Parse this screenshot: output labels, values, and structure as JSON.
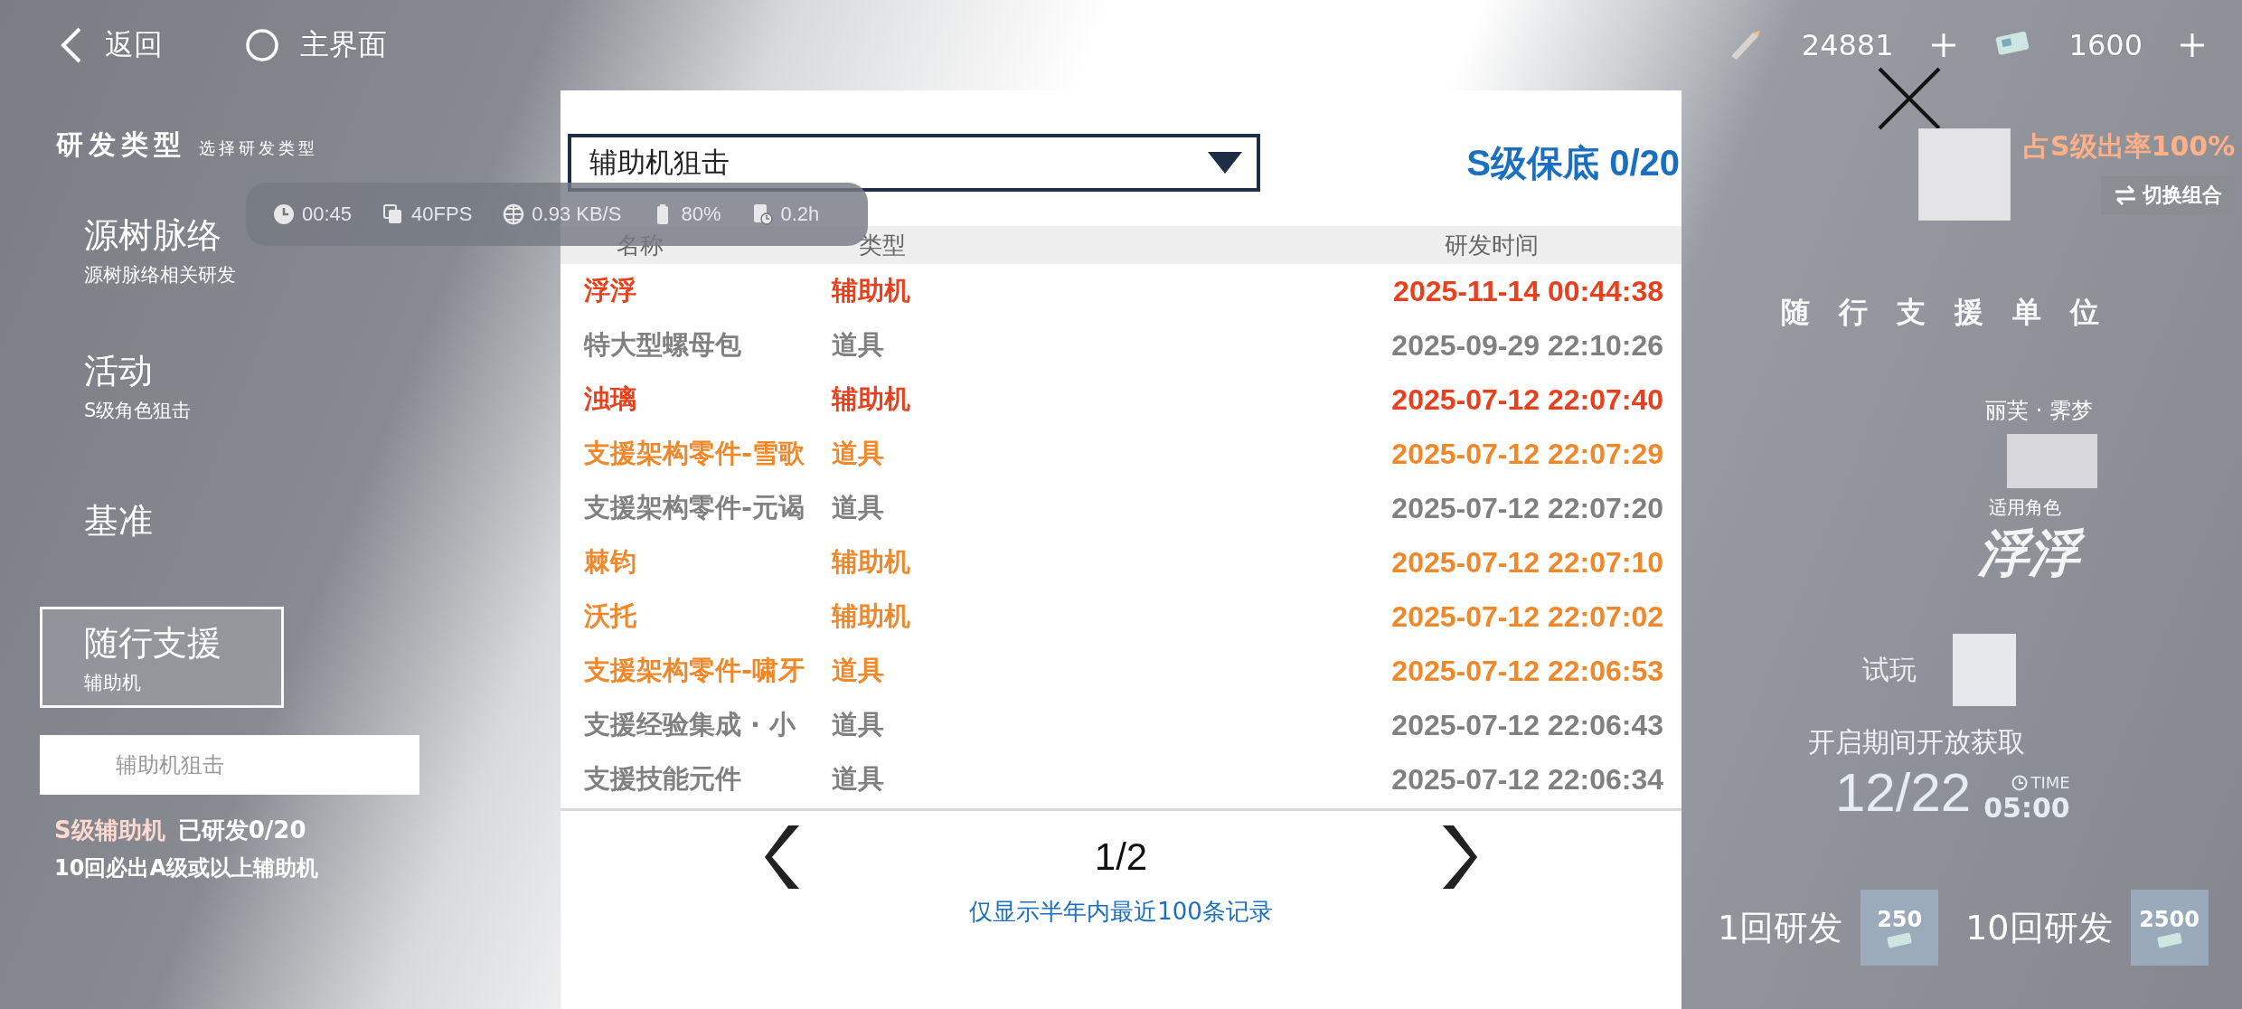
{
  "top_bar": {
    "back": "返回",
    "home": "主界面",
    "currencies": [
      {
        "amount": "24881"
      },
      {
        "amount": "1600"
      }
    ]
  },
  "sidebar": {
    "title": "研发类型",
    "subtitle": "选择研发类型",
    "items": [
      {
        "title": "源树脉络",
        "subtitle": "源树脉络相关研发",
        "selected": false
      },
      {
        "title": "活动",
        "subtitle": "S级角色狙击",
        "selected": false
      },
      {
        "title": "基准",
        "selected": false
      },
      {
        "title": "随行支援",
        "subtitle": "辅助机",
        "selected": true
      }
    ],
    "pool_tab": "辅助机狙击",
    "pool_grade": "S级辅助机",
    "pool_progress": "已研发0/20",
    "guarantee": "10回必出A级或以上辅助机"
  },
  "perf_overlay": [
    {
      "kind": "clock",
      "text": "00:45"
    },
    {
      "kind": "frames",
      "text": "40FPS"
    },
    {
      "kind": "network",
      "text": "0.93 KB/S"
    },
    {
      "kind": "battery",
      "text": "80%"
    },
    {
      "kind": "session",
      "text": "0.2h"
    }
  ],
  "history": {
    "dropdown": "辅助机狙击",
    "pity": "S级保底 0/20",
    "columns": [
      "名称",
      "类型",
      "研发时间"
    ],
    "rows": [
      {
        "name": "浮浮",
        "type": "辅助机",
        "time": "2025-11-14 00:44:38",
        "color": "#e8401c"
      },
      {
        "name": "特大型螺母包",
        "type": "道具",
        "time": "2025-09-29 22:10:26",
        "color": "#808080"
      },
      {
        "name": "浊璃",
        "type": "辅助机",
        "time": "2025-07-12 22:07:40",
        "color": "#e8401c"
      },
      {
        "name": "支援架构零件-雪歌",
        "type": "道具",
        "time": "2025-07-12 22:07:29",
        "color": "#f0882a"
      },
      {
        "name": "支援架构零件-元谒",
        "type": "道具",
        "time": "2025-07-12 22:07:20",
        "color": "#808080"
      },
      {
        "name": "棘钧",
        "type": "辅助机",
        "time": "2025-07-12 22:07:10",
        "color": "#f0882a"
      },
      {
        "name": "沃托",
        "type": "辅助机",
        "time": "2025-07-12 22:07:02",
        "color": "#f0882a"
      },
      {
        "name": "支援架构零件-啸牙",
        "type": "道具",
        "time": "2025-07-12 22:06:53",
        "color": "#f0882a"
      },
      {
        "name": "支援经验集成 · 小",
        "type": "道具",
        "time": "2025-07-12 22:06:43",
        "color": "#808080"
      },
      {
        "name": "支援技能元件",
        "type": "道具",
        "time": "2025-07-12 22:06:34",
        "color": "#808080"
      }
    ],
    "page": "1/2",
    "note": "仅显示半年内最近100条记录"
  },
  "promo": {
    "rate": "占S级出率100%",
    "switch": "切换组合",
    "unit_title": "随行支援单位",
    "character": "丽芙 · 霁梦",
    "applies": "适用角色",
    "unit_name": "浮浮",
    "trial": "试玩",
    "availability": "开启期间开放获取",
    "date": "12/22",
    "time_label": "TIME",
    "time": "05:00",
    "pulls": [
      {
        "label": "1回研发",
        "cost": "250"
      },
      {
        "label": "10回研发",
        "cost": "2500"
      }
    ]
  }
}
